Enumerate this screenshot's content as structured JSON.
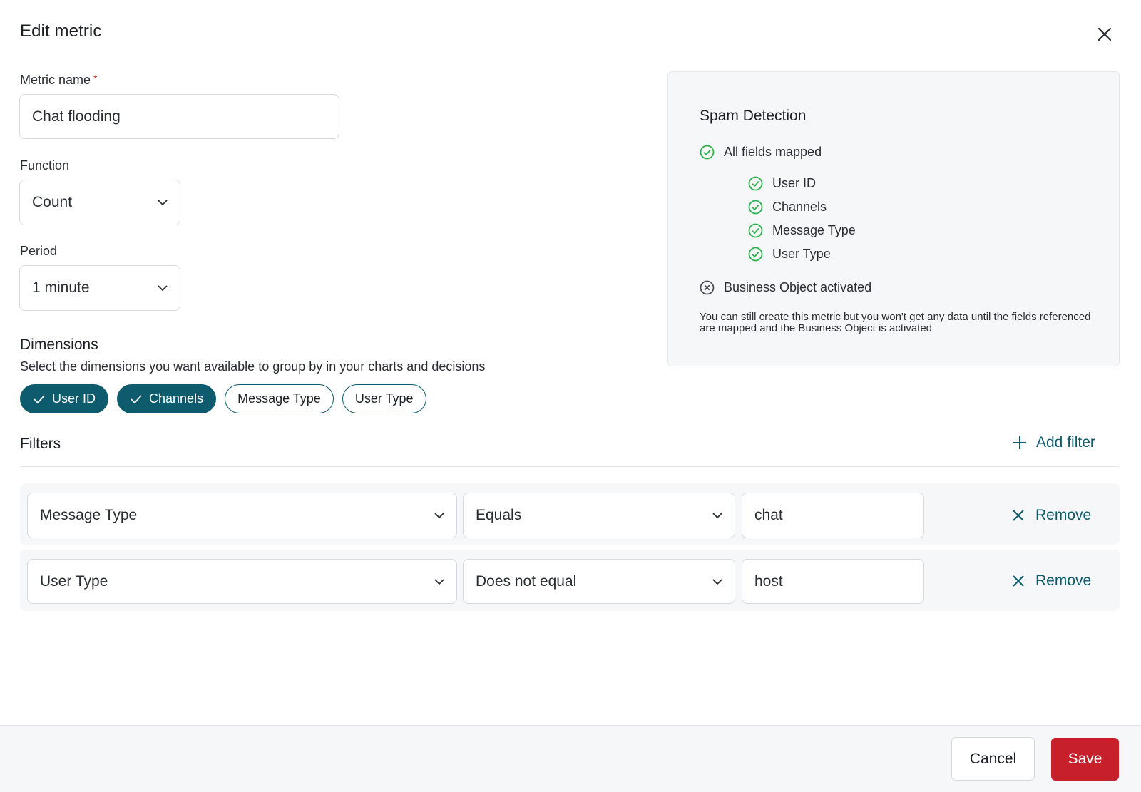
{
  "modal": {
    "title": "Edit metric"
  },
  "form": {
    "metric_name": {
      "label": "Metric name",
      "required_mark": "*",
      "value": "Chat flooding"
    },
    "function": {
      "label": "Function",
      "value": "Count"
    },
    "period": {
      "label": "Period",
      "value": "1 minute"
    }
  },
  "dimensions": {
    "title": "Dimensions",
    "helper": "Select the dimensions you want available to group by in your charts and decisions",
    "chips": [
      {
        "label": "User ID",
        "selected": true
      },
      {
        "label": "Channels",
        "selected": true
      },
      {
        "label": "Message Type",
        "selected": false
      },
      {
        "label": "User Type",
        "selected": false
      }
    ]
  },
  "filters": {
    "title": "Filters",
    "add_label": "Add filter",
    "rows": [
      {
        "field": "Message Type",
        "operator": "Equals",
        "value": "chat",
        "remove_label": "Remove"
      },
      {
        "field": "User Type",
        "operator": "Does not equal",
        "value": "host",
        "remove_label": "Remove"
      }
    ]
  },
  "panel": {
    "title": "Spam Detection",
    "fields_status": "All fields mapped",
    "fields": [
      "User ID",
      "Channels",
      "Message Type",
      "User Type"
    ],
    "business_object_status": "Business Object activated",
    "note": "You can still create this metric but you won't get any data until the fields referenced are mapped and the Business Object is activated"
  },
  "footer": {
    "cancel_label": "Cancel",
    "save_label": "Save"
  },
  "colors": {
    "primary": "#0d5b6c",
    "danger": "#c8202b",
    "success": "#2bb24c",
    "required": "#d12a2a",
    "panel_bg": "#f6f7f9"
  }
}
